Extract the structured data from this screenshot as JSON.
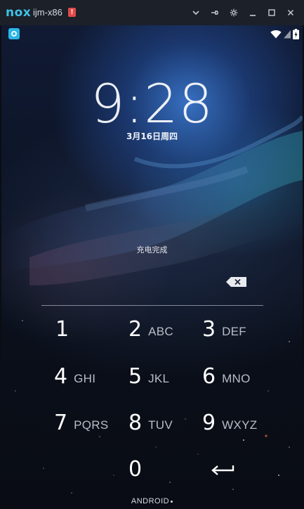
{
  "window": {
    "logo": "nox",
    "title": "ijm-x86",
    "warning_badge": "!",
    "controls": [
      "chevron-down-icon",
      "pin-icon",
      "gear-icon",
      "minimize-icon",
      "maximize-icon",
      "close-icon"
    ]
  },
  "status_bar": {
    "icons": [
      "wifi-icon",
      "signal-icon",
      "battery-charging-icon"
    ]
  },
  "lockscreen": {
    "time": "9:28",
    "date": "3月16日周四",
    "charging_status": "充电完成"
  },
  "keypad": {
    "keys": [
      {
        "digit": "1",
        "letters": ""
      },
      {
        "digit": "2",
        "letters": "ABC"
      },
      {
        "digit": "3",
        "letters": "DEF"
      },
      {
        "digit": "4",
        "letters": "GHI"
      },
      {
        "digit": "5",
        "letters": "JKL"
      },
      {
        "digit": "6",
        "letters": "MNO"
      },
      {
        "digit": "7",
        "letters": "PQRS"
      },
      {
        "digit": "8",
        "letters": "TUV"
      },
      {
        "digit": "9",
        "letters": "WXYZ"
      },
      {
        "digit": "0",
        "letters": ""
      }
    ],
    "backspace_icon": "backspace-icon",
    "enter_icon": "enter-arrow-icon"
  },
  "footer": {
    "label": "ANDROID"
  },
  "colors": {
    "titlebar": "#1c2029",
    "nox_brand": "#3fc2e8",
    "warning": "#e14a4a",
    "accent_blue": "#3e80dc"
  }
}
